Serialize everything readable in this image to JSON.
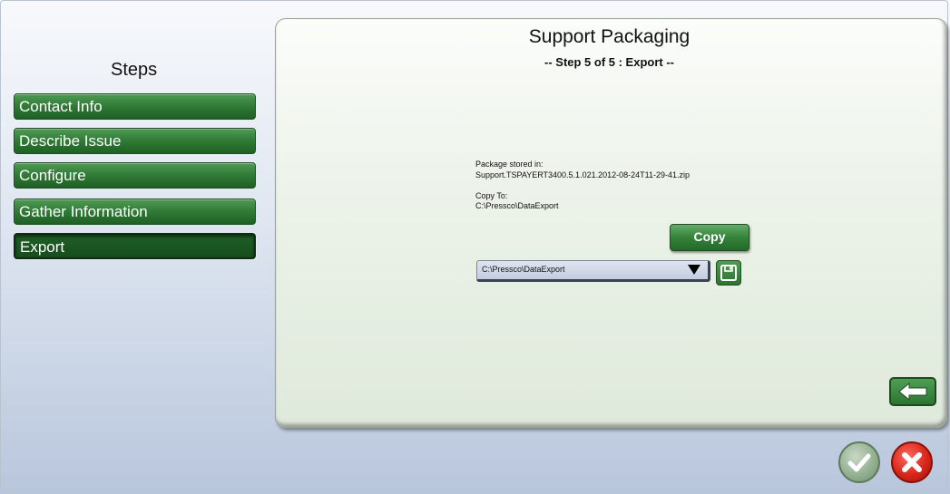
{
  "steps": {
    "title": "Steps",
    "items": [
      {
        "label": "Contact Info"
      },
      {
        "label": "Describe Issue"
      },
      {
        "label": "Configure"
      },
      {
        "label": "Gather Information"
      },
      {
        "label": "Export",
        "active": true
      }
    ]
  },
  "panel": {
    "title": "Support Packaging",
    "subtitle": "-- Step 5 of 5 : Export --",
    "package_label": "Package stored in:",
    "package_file": "Support.TSPAYERT3400.5.1.021.2012-08-24T11-29-41.zip",
    "copy_to_label": "Copy To:",
    "copy_to_path": "C:\\Pressco\\DataExport",
    "copy_button": "Copy",
    "dropdown_value": "C:\\Pressco\\DataExport"
  },
  "icons": {
    "save": "floppy-disk-icon",
    "back": "arrow-left-icon",
    "ok": "checkmark-icon",
    "cancel": "close-icon"
  },
  "colors": {
    "step_green": "#2f7a35",
    "cancel_red": "#d8261a",
    "ok_gray_green": "#8fae8d"
  }
}
